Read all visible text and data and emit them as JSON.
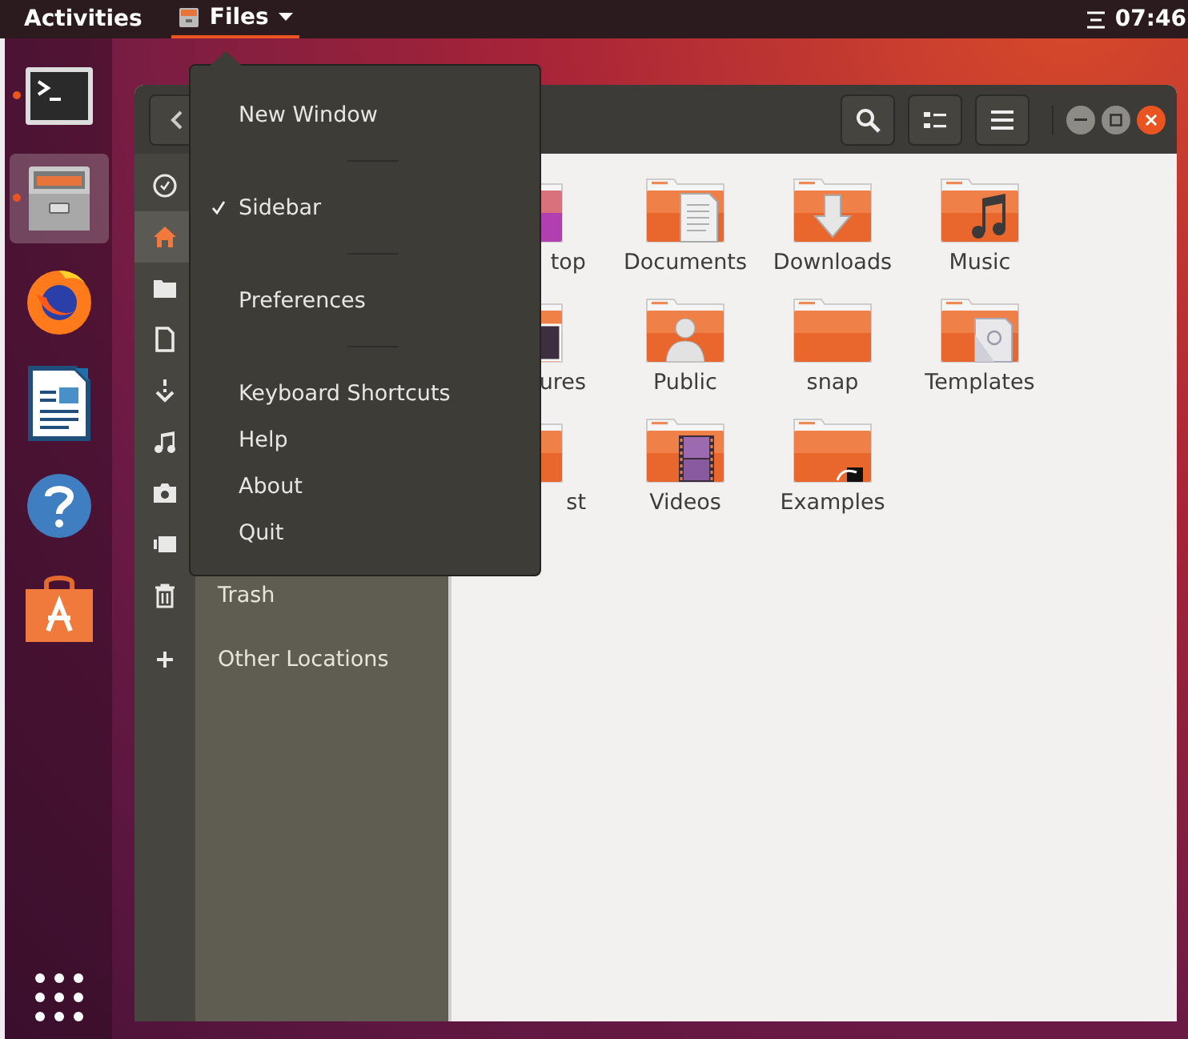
{
  "top_bar": {
    "activities": "Activities",
    "app_menu": {
      "label": "Files",
      "open": true
    },
    "clock": "07:46"
  },
  "dock": {
    "items": [
      {
        "running": true,
        "selected": false
      },
      {
        "running": true,
        "selected": true
      },
      {
        "running": false,
        "selected": false
      },
      {
        "running": false,
        "selected": false
      },
      {
        "running": false,
        "selected": false
      },
      {
        "running": false,
        "selected": false
      }
    ]
  },
  "sidebar": {
    "items": [
      {
        "kind": "recent",
        "selected": false
      },
      {
        "kind": "home",
        "selected": true
      },
      {
        "kind": "folder",
        "selected": false
      },
      {
        "kind": "document",
        "selected": false
      },
      {
        "kind": "download",
        "selected": false
      },
      {
        "kind": "music",
        "selected": false
      },
      {
        "kind": "camera",
        "selected": false
      },
      {
        "kind": "video",
        "selected": false
      },
      {
        "kind": "trash",
        "label": "Trash",
        "selected": false
      },
      {
        "kind": "plus",
        "label": "Other Locations",
        "selected": false
      }
    ]
  },
  "folders": [
    {
      "name": "top",
      "kind": "desktop",
      "cut": true
    },
    {
      "name": "Documents",
      "kind": "text"
    },
    {
      "name": "Downloads",
      "kind": "arrow"
    },
    {
      "name": "Music",
      "kind": "note"
    },
    {
      "name": "ures",
      "kind": "photo",
      "cut": true
    },
    {
      "name": "Public",
      "kind": "person"
    },
    {
      "name": "snap",
      "kind": "plain"
    },
    {
      "name": "Templates",
      "kind": "template"
    },
    {
      "name": "st",
      "kind": "plain",
      "cut": true
    },
    {
      "name": "Videos",
      "kind": "film"
    },
    {
      "name": "Examples",
      "kind": "link"
    }
  ],
  "app_menu_popup": {
    "items": [
      {
        "kind": "item",
        "label": "New Window",
        "checked": false
      },
      {
        "kind": "separator"
      },
      {
        "kind": "item",
        "label": "Sidebar",
        "checked": true
      },
      {
        "kind": "separator"
      },
      {
        "kind": "item",
        "label": "Preferences",
        "checked": false
      },
      {
        "kind": "separator"
      },
      {
        "kind": "item",
        "label": "Keyboard Shortcuts",
        "checked": false
      },
      {
        "kind": "item",
        "label": "Help",
        "checked": false
      },
      {
        "kind": "item",
        "label": "About",
        "checked": false
      },
      {
        "kind": "item",
        "label": "Quit",
        "checked": false
      }
    ]
  }
}
